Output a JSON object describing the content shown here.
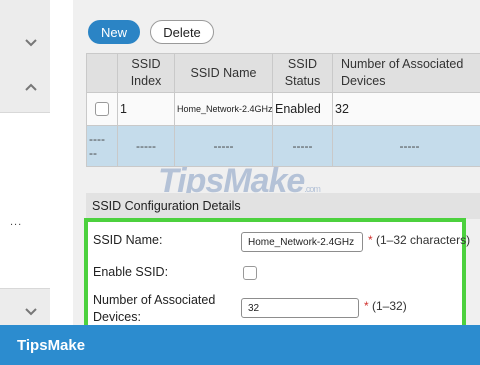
{
  "toolbar": {
    "new_label": "New",
    "delete_label": "Delete"
  },
  "table": {
    "headers": [
      "SSID Index",
      "SSID Name",
      "SSID Status",
      "Number of Associated Devices"
    ],
    "rows": [
      {
        "index": "1",
        "name": "Home_Network-2.4GHz",
        "status": "Enabled",
        "devices": "32"
      },
      {
        "select": "----\n--",
        "index": "-----",
        "name": "-----",
        "status": "-----",
        "devices": "-----"
      }
    ]
  },
  "config": {
    "section_title": "SSID Configuration Details",
    "ssid_name_label": "SSID Name:",
    "ssid_name_value": "Home_Network-2.4GHz",
    "ssid_name_hint": "(1–32 characters)",
    "enable_label": "Enable SSID:",
    "enable_checked": false,
    "devices_label_line1": "Number of Associated",
    "devices_label_line2": "Devices:",
    "devices_value": "32",
    "devices_hint": "(1–32)",
    "required_mark": "*"
  },
  "sidebar": {
    "truncated_text": "..."
  },
  "watermark": {
    "text": "TipsMake",
    "suffix": ".com"
  },
  "footer": {
    "brand": "TipsMake"
  },
  "colors": {
    "accent": "#2b84c5",
    "highlight_border": "#4cd13e",
    "footer": "#2c8ccf",
    "selected_row": "#c5dceb"
  }
}
